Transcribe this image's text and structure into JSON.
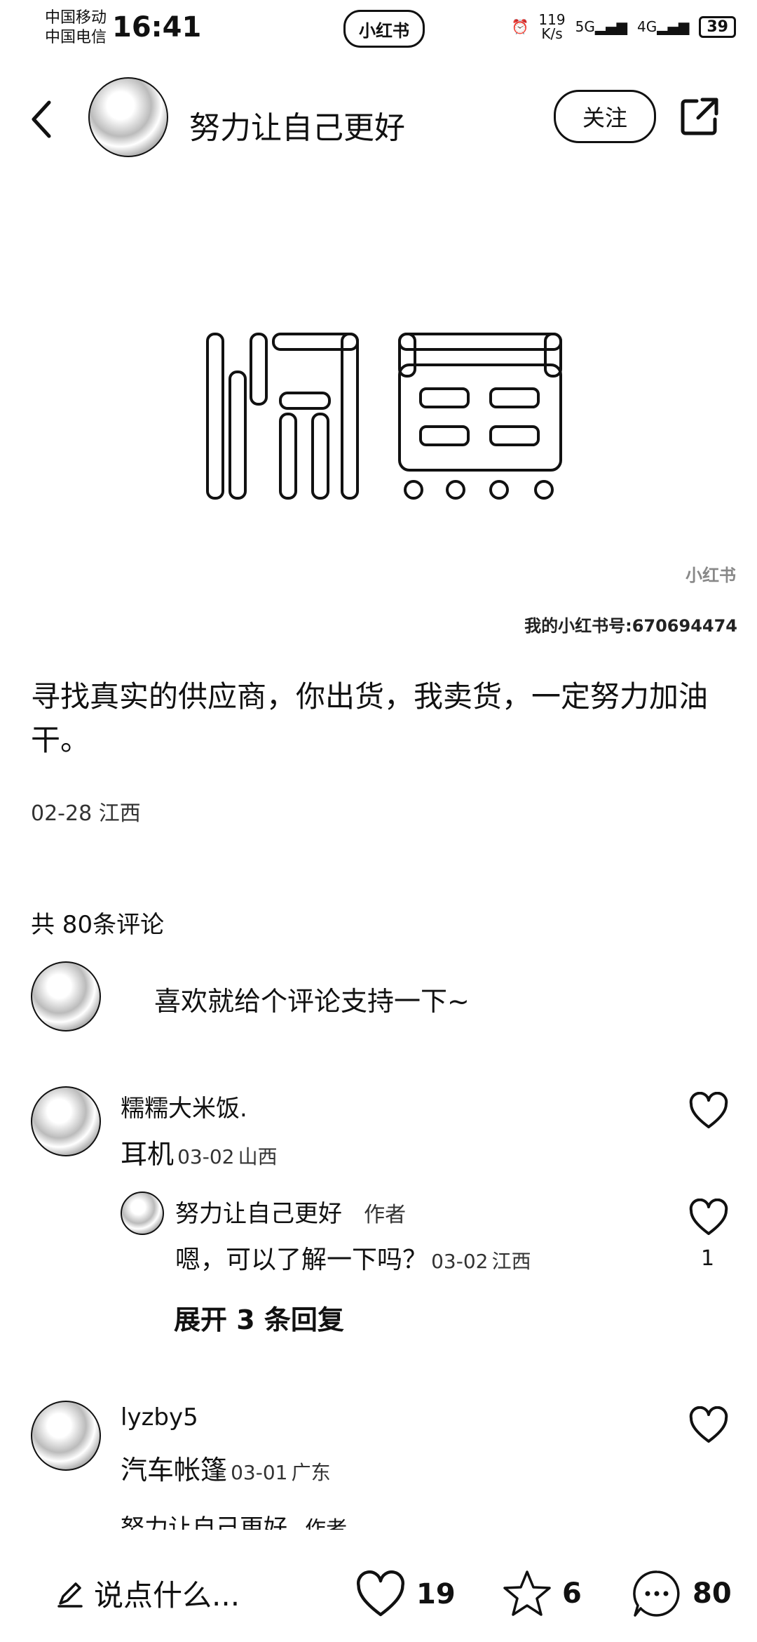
{
  "status": {
    "carrier1": "中国移动",
    "carrier2": "中国电信",
    "time": "16:41",
    "app_badge": "小红书",
    "speed_top": "119",
    "speed_unit": "K/s",
    "net1": "5G",
    "net2": "4G",
    "battery": "39"
  },
  "header": {
    "author": "努力让自己更好",
    "follow_label": "关注"
  },
  "watermark": {
    "brand": "小红书",
    "id_text": "我的小红书号:670694474"
  },
  "post": {
    "text": "寻找真实的供应商，你出货，我卖货，一定努力加油干。",
    "date": "02-28",
    "location": "江西"
  },
  "comments_section": {
    "count_label": "共 80条评论",
    "input_hint": "喜欢就给个评论支持一下~"
  },
  "comments": [
    {
      "name": "糯糯大米饭.",
      "text": "耳机",
      "date": "03-02",
      "location": "山西",
      "reply": {
        "name": "努力让自己更好",
        "tag": "作者",
        "text": "嗯，可以了解一下吗？",
        "date": "03-02",
        "location": "江西",
        "likes": "1"
      },
      "expand_label": "展开 3 条回复"
    },
    {
      "name": "lyzby5",
      "text": "汽车帐篷",
      "date": "03-01",
      "location": "广东",
      "reply_partial": "努力让自己更好",
      "reply_partial_tag": "作者"
    }
  ],
  "bottom": {
    "say_label": "说点什么...",
    "likes": "19",
    "stars": "6",
    "comments": "80"
  }
}
